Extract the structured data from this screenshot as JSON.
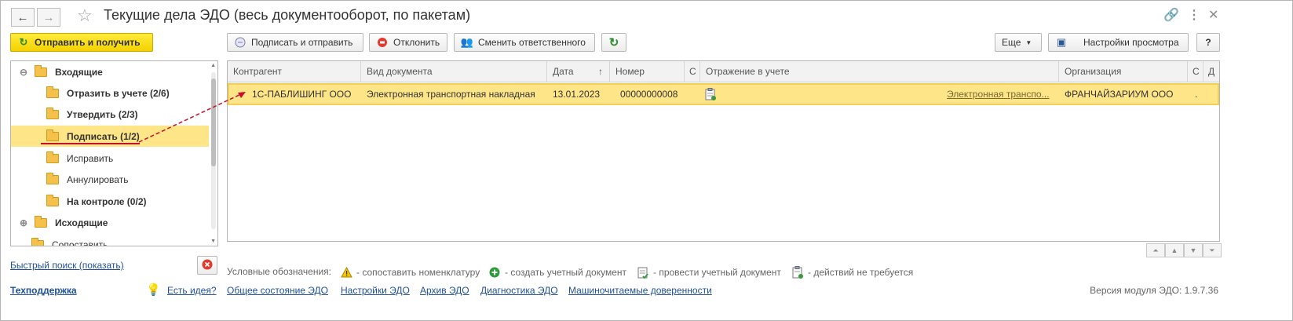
{
  "window": {
    "title": "Текущие дела ЭДО (весь документооборот, по пакетам)"
  },
  "toolbar_left": {
    "send_receive": "Отправить и получить"
  },
  "toolbar_main": {
    "sign_send": "Подписать и отправить",
    "reject": "Отклонить",
    "change_responsible": "Сменить ответственного",
    "more": "Еще",
    "view_settings": "Настройки просмотра",
    "help": "?"
  },
  "tree": {
    "items": [
      {
        "label": "Входящие",
        "bold": true
      },
      {
        "label": "Отразить в учете (2/6)",
        "bold": true
      },
      {
        "label": "Утвердить (2/3)",
        "bold": true
      },
      {
        "label": "Подписать (1/2)",
        "bold": true
      },
      {
        "label": "Исправить",
        "bold": false
      },
      {
        "label": "Аннулировать",
        "bold": false
      },
      {
        "label": "На контроле (0/2)",
        "bold": true
      },
      {
        "label": "Исходящие",
        "bold": true
      },
      {
        "label": "Сопоставить",
        "bold": false
      }
    ]
  },
  "grid": {
    "columns": [
      "Контрагент",
      "Вид документа",
      "Дата",
      "Номер",
      "С",
      "Отражение в учете",
      "Организация",
      "С",
      "Д"
    ],
    "rows": [
      {
        "counterparty": "1С-ПАБЛИШИНГ ООО",
        "doc_type": "Электронная транспортная накладная",
        "date": "13.01.2023",
        "number": "00000000008",
        "accounting_link": "Электронная транспо...",
        "organization": "ФРАНЧАЙЗАРИУМ ООО",
        "extra": "."
      }
    ]
  },
  "quick_search": "Быстрый поиск (показать)",
  "legend": {
    "title": "Условные обозначения:",
    "match": "- сопоставить номенклатуру",
    "create": "- создать учетный документ",
    "post": "- провести учетный документ",
    "none": "- действий не требуется"
  },
  "footer": {
    "support": "Техподдержка",
    "idea": "Есть идея?",
    "general_state": "Общее состояние ЭДО",
    "settings": "Настройки ЭДО",
    "archive": "Архив ЭДО",
    "diagnostics": "Диагностика ЭДО",
    "proxies": "Машиночитаемые доверенности",
    "version": "Версия модуля ЭДО: 1.9.7.36"
  },
  "colors": {
    "accent_yellow": "#fde588",
    "button_yellow": "#ffeb3b",
    "link_blue": "#1f4f9a",
    "annotation_red": "#c8102e"
  }
}
